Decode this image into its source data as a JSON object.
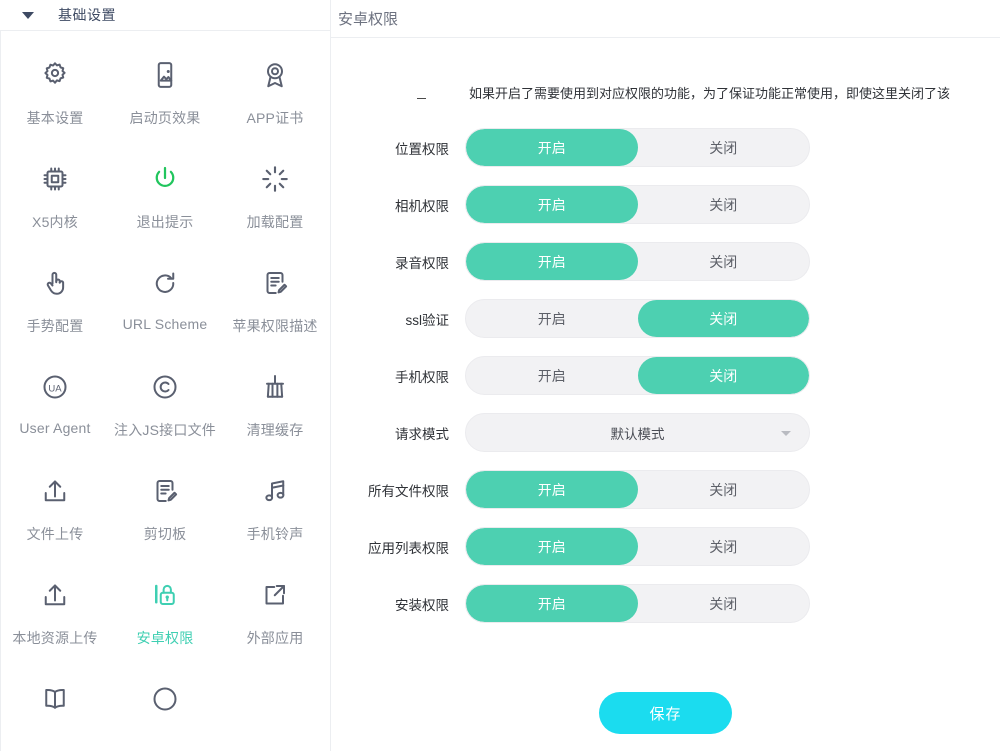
{
  "sidebar": {
    "header": {
      "title": "基础设置",
      "caret": "caret-down-icon"
    },
    "items": [
      {
        "label": "基本设置",
        "icon": "gear-icon",
        "active": false
      },
      {
        "label": "启动页效果",
        "icon": "splash-image-icon",
        "active": false
      },
      {
        "label": "APP证书",
        "icon": "certificate-icon",
        "active": false
      },
      {
        "label": "X5内核",
        "icon": "chip-icon",
        "active": false
      },
      {
        "label": "退出提示",
        "icon": "power-icon",
        "active": false
      },
      {
        "label": "加载配置",
        "icon": "loading-icon",
        "active": false
      },
      {
        "label": "手势配置",
        "icon": "hand-tap-icon",
        "active": false
      },
      {
        "label": "URL Scheme",
        "icon": "refresh-icon",
        "active": false
      },
      {
        "label": "苹果权限描述",
        "icon": "doc-edit-icon",
        "active": false
      },
      {
        "label": "User Agent",
        "icon": "ua-circle-icon",
        "active": false
      },
      {
        "label": "注入JS接口文件",
        "icon": "copyright-icon",
        "active": false
      },
      {
        "label": "清理缓存",
        "icon": "broom-icon",
        "active": false
      },
      {
        "label": "文件上传",
        "icon": "upload-icon",
        "active": false
      },
      {
        "label": "剪切板",
        "icon": "doc-edit-icon",
        "active": false
      },
      {
        "label": "手机铃声",
        "icon": "music-note-icon",
        "active": false
      },
      {
        "label": "本地资源上传",
        "icon": "upload-icon",
        "active": false
      },
      {
        "label": "安卓权限",
        "icon": "lock-icon",
        "active": true
      },
      {
        "label": "外部应用",
        "icon": "external-link-icon",
        "active": false
      }
    ]
  },
  "main": {
    "header": {
      "title": "安卓权限"
    },
    "notice": "如果开启了需要使用到对应权限的功能，为了保证功能正常使用，即使这里关闭了该",
    "toggle_labels": {
      "on": "开启",
      "off": "关闭"
    },
    "rows": [
      {
        "label": "位置权限",
        "type": "toggle",
        "value": "on"
      },
      {
        "label": "相机权限",
        "type": "toggle",
        "value": "on"
      },
      {
        "label": "录音权限",
        "type": "toggle",
        "value": "on"
      },
      {
        "label": "ssl验证",
        "type": "toggle",
        "value": "off"
      },
      {
        "label": "手机权限",
        "type": "toggle",
        "value": "off"
      },
      {
        "label": "请求模式",
        "type": "select",
        "value": "默认模式"
      },
      {
        "label": "所有文件权限",
        "type": "toggle",
        "value": "on"
      },
      {
        "label": "应用列表权限",
        "type": "toggle",
        "value": "on"
      },
      {
        "label": "安装权限",
        "type": "toggle",
        "value": "on"
      }
    ],
    "save_label": "保存"
  },
  "colors": {
    "toggle_active": "#4dd0b1",
    "save_button": "#1bdcef",
    "accent_active_item": "#3ecfb2",
    "track": "#f2f2f4",
    "text_primary": "#2f3237",
    "text_muted": "#8a8f99"
  }
}
